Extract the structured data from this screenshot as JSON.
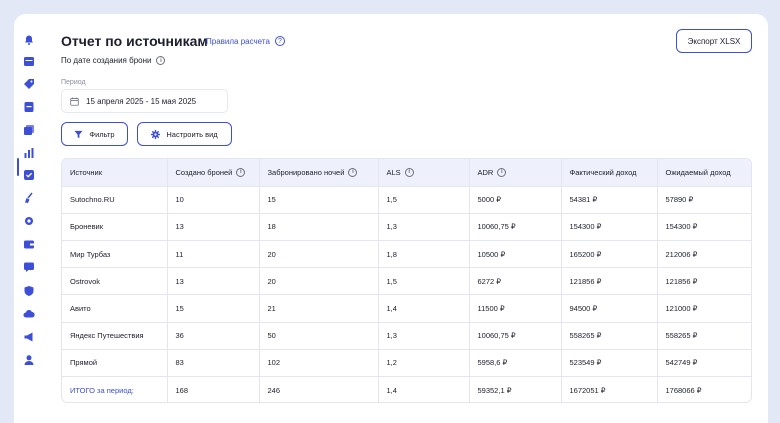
{
  "sidebar": {
    "icons": [
      {
        "name": "bell-icon"
      },
      {
        "name": "calendar-icon"
      },
      {
        "name": "tag-icon"
      },
      {
        "name": "booking-icon"
      },
      {
        "name": "documents-icon"
      },
      {
        "name": "chart-icon",
        "active": true
      },
      {
        "name": "checkbox-icon"
      },
      {
        "name": "broom-icon"
      },
      {
        "name": "settings-icon"
      },
      {
        "name": "wallet-icon"
      },
      {
        "name": "chat-icon"
      },
      {
        "name": "shield-icon"
      },
      {
        "name": "cloud-icon"
      },
      {
        "name": "megaphone-icon"
      },
      {
        "name": "user-icon"
      }
    ],
    "accent": "#3d4fd6"
  },
  "header": {
    "title": "Отчет по источникам",
    "rules_link": "Правила расчета",
    "subtitle": "По дате создания брони",
    "export_label": "Экспорт XLSX"
  },
  "filters": {
    "period_label": "Период",
    "period_value": "15 апреля 2025 - 15 мая 2025",
    "filter_label": "Фильтр",
    "view_label": "Настроить вид"
  },
  "table": {
    "columns": [
      "Источник",
      "Создано броней",
      "Забронировано ночей",
      "ALS",
      "ADR",
      "Фактический доход",
      "Ожидаемый доход"
    ],
    "rows": [
      [
        "Sutochno.RU",
        "10",
        "15",
        "1,5",
        "5000 ₽",
        "54381 ₽",
        "57890 ₽"
      ],
      [
        "Броневик",
        "13",
        "18",
        "1,3",
        "10060,75 ₽",
        "154300 ₽",
        "154300 ₽"
      ],
      [
        "Мир Турбаз",
        "11",
        "20",
        "1,8",
        "10500 ₽",
        "165200 ₽",
        "212006 ₽"
      ],
      [
        "Ostrovok",
        "13",
        "20",
        "1,5",
        "6272 ₽",
        "121856 ₽",
        "121856 ₽"
      ],
      [
        "Авито",
        "15",
        "21",
        "1,4",
        "11500 ₽",
        "94500 ₽",
        "121000 ₽"
      ],
      [
        "Яндекс Путешествия",
        "36",
        "50",
        "1,3",
        "10060,75 ₽",
        "558265 ₽",
        "558265 ₽"
      ],
      [
        "Прямой",
        "83",
        "102",
        "1,2",
        "5958,6 ₽",
        "523549 ₽",
        "542749 ₽"
      ]
    ],
    "total": [
      "ИТОГО за период:",
      "168",
      "246",
      "1,4",
      "59352,1 ₽",
      "1672051 ₽",
      "1768066 ₽"
    ]
  }
}
